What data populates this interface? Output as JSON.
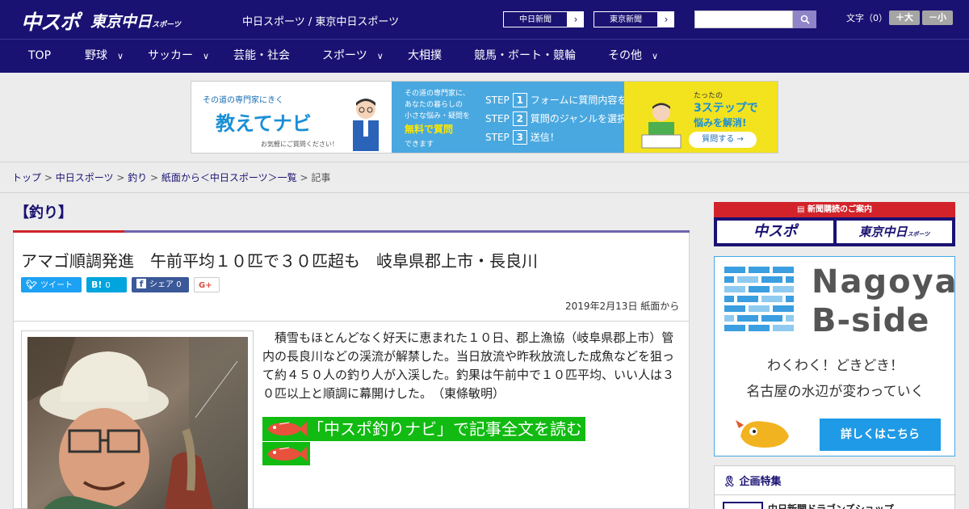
{
  "header": {
    "logo_main": "中スポ",
    "logo_tokyo": "東京中日",
    "logo_tokyo_suffix": "スポーツ",
    "site_title": "中日スポーツ / 東京中日スポーツ",
    "ext_links": [
      {
        "label": "中日新聞",
        "arrow": "›"
      },
      {
        "label": "東京新聞",
        "arrow": "›"
      }
    ],
    "search": {
      "placeholder": "",
      "button_icon": "search-icon"
    },
    "font_size_label": "文字（0）",
    "font_larger": "＋大",
    "font_smaller": "－小"
  },
  "nav": {
    "items": [
      {
        "label": "TOP",
        "chevron": ""
      },
      {
        "label": "野球",
        "chevron": "∨"
      },
      {
        "label": "サッカー",
        "chevron": "∨"
      },
      {
        "label": "芸能・社会",
        "chevron": ""
      },
      {
        "label": "スポーツ",
        "chevron": "∨"
      },
      {
        "label": "大相撲",
        "chevron": ""
      },
      {
        "label": "競馬・ボート・競輪",
        "chevron": ""
      },
      {
        "label": "その他",
        "chevron": "∨"
      }
    ]
  },
  "banner": {
    "a_lead": "その道の専門家にきく",
    "a_title": "教えてナビ",
    "a_note": "お気軽にご質問ください！",
    "b_text1": "その道の専門家に、",
    "b_text2": "あなたの暮らしの",
    "b_text3": "小さな悩み・疑問を",
    "b_highlight": "無料で質問",
    "b_text4": "できます",
    "steps": [
      {
        "prefix": "STEP",
        "num": "1",
        "text": "フォームに質問内容を入力"
      },
      {
        "prefix": "STEP",
        "num": "2",
        "text": "質問のジャンルを選択"
      },
      {
        "prefix": "STEP",
        "num": "3",
        "text": "送信！"
      }
    ],
    "c_lead": "たったの",
    "c_main": "3ステップで",
    "c_sub": "悩みを解消!",
    "c_button": "質問する →"
  },
  "breadcrumb": {
    "items": [
      "トップ",
      "中日スポーツ",
      "釣り",
      "紙面から＜中日スポーツ＞一覧"
    ],
    "separator": " > ",
    "current": "記事"
  },
  "article": {
    "category": "【釣り】",
    "headline": "アマゴ順調発進　午前平均１０匹で３０匹超も　岐阜県郡上市・長良川",
    "share": {
      "tweet": "ツイート",
      "hatena_icon": "B!",
      "hatena_count": "0",
      "facebook_label": "シェア",
      "facebook_count": "0",
      "gplus": "G+"
    },
    "date": "2019年2月13日 紙面から",
    "body": "積雪もほとんどなく好天に恵まれた１０日、郡上漁協（岐阜県郡上市）管内の長良川などの渓流が解禁した。当日放流や昨秋放流した成魚などを狙って約４５０人の釣り人が入渓した。釣果は午前中で１０匹平均、いい人は３０匹以上と順調に幕開けした。　（東條敏明）",
    "read_more": "「中スポ釣りナビ」で記事全文を読む"
  },
  "sidebar": {
    "subscribe_header": "新聞購読のご案内",
    "subscribe_chuspo": "中スポ",
    "subscribe_tokyo": "東京中日",
    "subscribe_tokyo_suffix": "スポーツ",
    "bside_title1": "Nagoya",
    "bside_title2": "B-side",
    "bside_line1": "わくわく！どきどき！",
    "bside_line2": "名古屋の水辺が変わっていく",
    "bside_cta": "詳しくはこちら",
    "special_header": "企画特集",
    "special_item": "中日新聞ドラゴンズショップ"
  },
  "colors": {
    "header_bg": "#1a1272",
    "accent_red": "#d2232a",
    "accent_purple": "#6e66ad",
    "read_more_green": "#11bb11",
    "twitter": "#1da1f2",
    "hatena": "#00a4de",
    "facebook": "#3b5998"
  }
}
